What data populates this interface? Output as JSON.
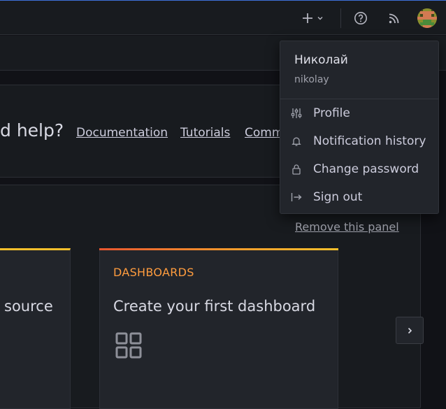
{
  "topbar": {
    "add_icon": "plus-icon",
    "add_menu_icon": "chevron-down-icon",
    "help_icon": "question-circle-icon",
    "news_icon": "rss-icon",
    "avatar_icon": "user-avatar"
  },
  "help": {
    "title": "d help?",
    "links": [
      "Documentation",
      "Tutorials",
      "Comm"
    ]
  },
  "panel": {
    "remove_label": "Remove this panel"
  },
  "cards": [
    {
      "title": "source"
    },
    {
      "kind": "DASHBOARDS",
      "title": "Create your first dashboard",
      "icon": "apps-icon"
    }
  ],
  "carousel": {
    "next_icon": "chevron-right-icon"
  },
  "user_menu": {
    "name": "Николай",
    "login": "nikolay",
    "items": [
      {
        "label": "Profile",
        "icon": "sliders-icon"
      },
      {
        "label": "Notification history",
        "icon": "bell-icon"
      },
      {
        "label": "Change password",
        "icon": "lock-icon"
      },
      {
        "label": "Sign out",
        "icon": "sign-out-icon"
      }
    ]
  },
  "colors": {
    "accent_top": "#3d71d9",
    "card_gradient_start": "#e8562f",
    "card_gradient_end": "#f6c02c",
    "dashboards_label": "#ff9c3e"
  }
}
